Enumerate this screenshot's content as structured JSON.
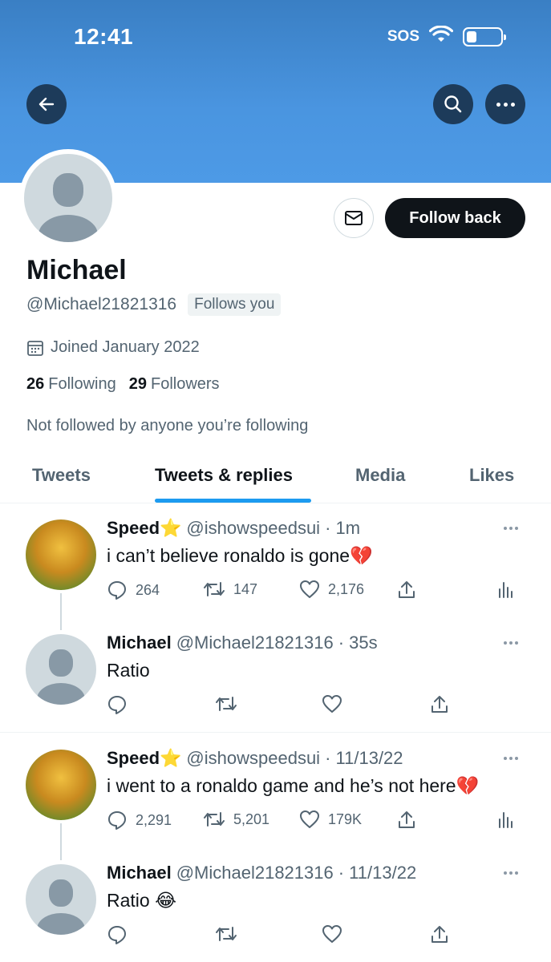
{
  "status_bar": {
    "time": "12:41",
    "carrier": "SOS",
    "battery_level": 0.3
  },
  "header": {
    "back_icon": "arrow-left-icon",
    "search_icon": "search-icon",
    "more_icon": "more-dots-icon"
  },
  "profile": {
    "name": "Michael",
    "handle": "@Michael21821316",
    "follows_you": "Follows you",
    "joined": "Joined January 2022",
    "following_count": "26",
    "following_label": "Following",
    "followers_count": "29",
    "followers_label": "Followers",
    "not_followed": "Not followed by anyone you’re following",
    "follow_button": "Follow back",
    "message_icon": "envelope-icon"
  },
  "tabs": [
    {
      "label": "Tweets",
      "active": false
    },
    {
      "label": "Tweets & replies",
      "active": true
    },
    {
      "label": "Media",
      "active": false
    },
    {
      "label": "Likes",
      "active": false
    }
  ],
  "tweets": [
    {
      "name": "Speed⭐",
      "handle": "@ishowspeedsui",
      "time": "· 1m",
      "text": "i can’t believe ronaldo is gone💔",
      "replies": "264",
      "retweets": "147",
      "likes": "2,176"
    },
    {
      "name": "Michael",
      "handle": "@Michael21821316",
      "time": "· 35s",
      "text": "Ratio"
    },
    {
      "name": "Speed⭐",
      "handle": "@ishowspeedsui",
      "time": "· 11/13/22",
      "text": "i went to a ronaldo game and he’s not here💔",
      "replies": "2,291",
      "retweets": "5,201",
      "likes": "179K"
    },
    {
      "name": "Michael",
      "handle": "@Michael21821316",
      "time": "· 11/13/22",
      "text": "Ratio 😂"
    }
  ]
}
